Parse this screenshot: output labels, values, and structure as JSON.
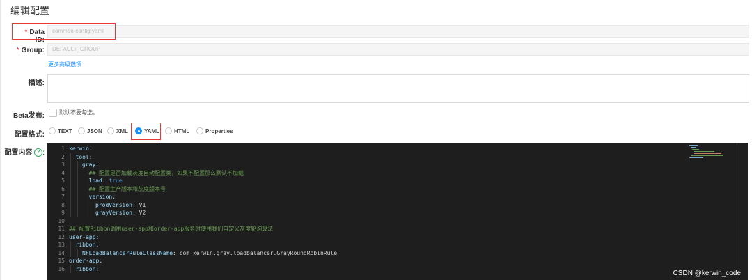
{
  "page": {
    "title": "编辑配置"
  },
  "form": {
    "data_id": {
      "label": "Data ID:",
      "value": "common-config.yaml"
    },
    "group": {
      "label": "Group:",
      "value": "DEFAULT_GROUP"
    },
    "advanced_link": "更多高级选项",
    "description": {
      "label": "描述:",
      "value": ""
    },
    "beta": {
      "label": "Beta发布:",
      "checkbox_label": "默认不要勾选。",
      "checked": false
    },
    "format": {
      "label": "配置格式:",
      "options": [
        "TEXT",
        "JSON",
        "XML",
        "YAML",
        "HTML",
        "Properties"
      ],
      "selected": "YAML"
    },
    "content": {
      "label": "配置内容",
      "help_icon": "question-circle-icon"
    }
  },
  "editor": {
    "lines": [
      {
        "n": "1",
        "ind": 0,
        "parts": [
          [
            "k",
            "kerwin"
          ],
          [
            "t",
            ":"
          ]
        ]
      },
      {
        "n": "2",
        "ind": 1,
        "parts": [
          [
            "k",
            "tool"
          ],
          [
            "t",
            ":"
          ]
        ]
      },
      {
        "n": "3",
        "ind": 2,
        "parts": [
          [
            "k",
            "gray"
          ],
          [
            "t",
            ":"
          ]
        ]
      },
      {
        "n": "4",
        "ind": 3,
        "parts": [
          [
            "c",
            "## 配置是否加载灰度自动配置类，如果不配置那么默认不加载"
          ]
        ]
      },
      {
        "n": "5",
        "ind": 3,
        "parts": [
          [
            "k",
            "load"
          ],
          [
            "t",
            ": "
          ],
          [
            "b",
            "true"
          ]
        ]
      },
      {
        "n": "6",
        "ind": 3,
        "parts": [
          [
            "c",
            "## 配置生产版本和灰度版本号"
          ]
        ]
      },
      {
        "n": "7",
        "ind": 3,
        "parts": [
          [
            "k",
            "version"
          ],
          [
            "t",
            ":"
          ]
        ]
      },
      {
        "n": "8",
        "ind": 4,
        "parts": [
          [
            "k",
            "prodVersion"
          ],
          [
            "t",
            ": "
          ],
          [
            "t",
            "V1"
          ]
        ]
      },
      {
        "n": "9",
        "ind": 4,
        "parts": [
          [
            "k",
            "grayVersion"
          ],
          [
            "t",
            ": "
          ],
          [
            "t",
            "V2"
          ]
        ]
      },
      {
        "n": "10",
        "ind": 0,
        "parts": []
      },
      {
        "n": "11",
        "ind": 0,
        "parts": [
          [
            "c",
            "## 配置Ribbon调用user-app和order-app服务时使用我们自定义灰度轮询算法"
          ]
        ]
      },
      {
        "n": "12",
        "ind": 0,
        "parts": [
          [
            "k",
            "user-app"
          ],
          [
            "t",
            ":"
          ]
        ]
      },
      {
        "n": "13",
        "ind": 1,
        "parts": [
          [
            "k",
            "ribbon"
          ],
          [
            "t",
            ":"
          ]
        ]
      },
      {
        "n": "14",
        "ind": 2,
        "parts": [
          [
            "k",
            "NFLoadBalancerRuleClassName"
          ],
          [
            "t",
            ": "
          ],
          [
            "t",
            "com.kerwin.gray.loadbalancer.GrayRoundRobinRule"
          ]
        ]
      },
      {
        "n": "15",
        "ind": 0,
        "parts": [
          [
            "k",
            "order-app"
          ],
          [
            "t",
            ":"
          ]
        ]
      },
      {
        "n": "16",
        "ind": 1,
        "parts": [
          [
            "k",
            "ribbon"
          ],
          [
            "t",
            ":"
          ]
        ]
      }
    ]
  },
  "watermark": "CSDN @kerwin_code",
  "colors": {
    "accent": "#1890ff",
    "highlight": "#e53935",
    "editor_bg": "#1e1e1e"
  }
}
